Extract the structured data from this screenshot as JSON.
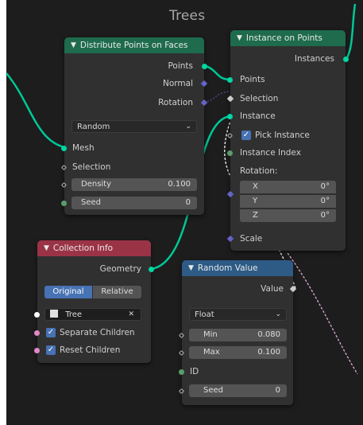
{
  "frame": {
    "title": "Trees"
  },
  "distribute": {
    "title": "Distribute Points on Faces",
    "out_points": "Points",
    "out_normal": "Normal",
    "out_rotation": "Rotation",
    "mode": "Random",
    "in_mesh": "Mesh",
    "in_selection": "Selection",
    "density_label": "Density",
    "density_value": "0.100",
    "seed_label": "Seed",
    "seed_value": "0"
  },
  "instance": {
    "title": "Instance on Points",
    "out_instances": "Instances",
    "in_points": "Points",
    "in_selection": "Selection",
    "in_instance": "Instance",
    "pick_instance": "Pick Instance",
    "instance_index": "Instance Index",
    "rotation_label": "Rotation:",
    "rot_x_label": "X",
    "rot_x_value": "0°",
    "rot_y_label": "Y",
    "rot_y_value": "0°",
    "rot_z_label": "Z",
    "rot_z_value": "0°",
    "in_scale": "Scale"
  },
  "collection": {
    "title": "Collection Info",
    "out_geometry": "Geometry",
    "seg_original": "Original",
    "seg_relative": "Relative",
    "collection_value": "Tree",
    "separate_children": "Separate Children",
    "reset_children": "Reset Children"
  },
  "random": {
    "title": "Random Value",
    "out_value": "Value",
    "type": "Float",
    "min_label": "Min",
    "min_value": "0.080",
    "max_label": "Max",
    "max_value": "0.100",
    "in_id": "ID",
    "seed_label": "Seed",
    "seed_value": "0"
  },
  "colors": {
    "geometry_socket": "#00d6a3",
    "vector_socket": "#6363c7",
    "float_socket": "#a1a1a1",
    "header_geometry": "#1e6b4e",
    "header_input": "#9b3346",
    "header_utility": "#2d5b86",
    "accent": "#4772b3"
  }
}
